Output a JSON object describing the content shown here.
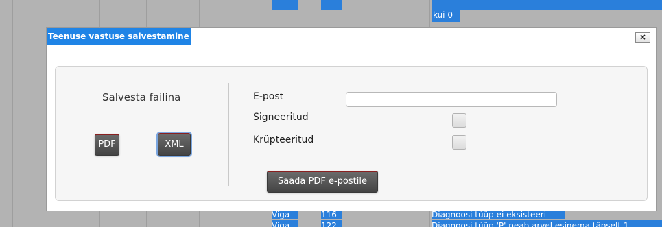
{
  "background": {
    "top_cell_text": "kui 0",
    "bottom_rows": [
      {
        "status": "Viga",
        "code": "116",
        "message": "Diagnoosi tüüp ei eksisteeri"
      },
      {
        "status": "Viga",
        "code": "122",
        "message": "Diagnoosi tüüp 'P' peab arvel esinema täpselt 1"
      }
    ]
  },
  "dialog": {
    "title": "Teenuse vastuse salvestamine",
    "close_label": "×",
    "save_section": {
      "heading": "Salvesta failina",
      "pdf_button": "PDF",
      "xml_button": "XML"
    },
    "email_section": {
      "email_label": "E-post",
      "email_value": "",
      "email_placeholder": "",
      "signed_label": "Signeeritud",
      "signed_checked": false,
      "encrypted_label": "Krüpteeritud",
      "encrypted_checked": false,
      "send_button": "Saada PDF e-postile"
    }
  },
  "colors": {
    "title_bar": "#1f84e6",
    "button": "#555555",
    "highlight": "#2a7fdb"
  }
}
